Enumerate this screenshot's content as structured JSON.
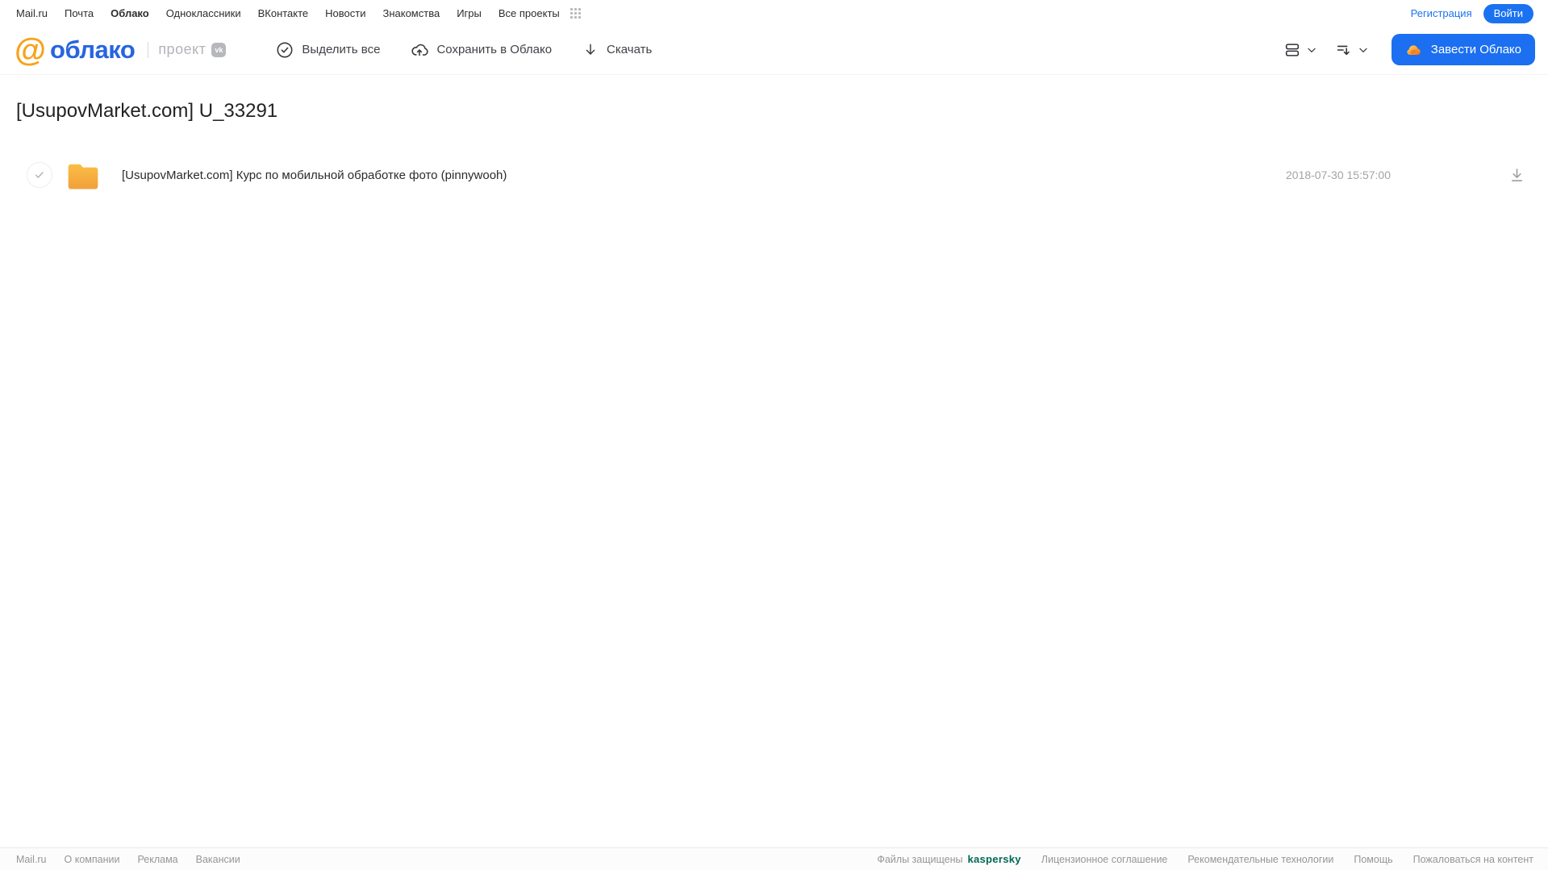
{
  "top_nav": {
    "links": [
      {
        "label": "Mail.ru",
        "active": false
      },
      {
        "label": "Почта",
        "active": false
      },
      {
        "label": "Облако",
        "active": true
      },
      {
        "label": "Одноклассники",
        "active": false
      },
      {
        "label": "ВКонтакте",
        "active": false
      },
      {
        "label": "Новости",
        "active": false
      },
      {
        "label": "Знакомства",
        "active": false
      },
      {
        "label": "Игры",
        "active": false
      },
      {
        "label": "Все проекты",
        "active": false
      }
    ],
    "registration_label": "Регистрация",
    "login_label": "Войти"
  },
  "header": {
    "logo_at": "@",
    "logo_text": "облако",
    "project_label": "проект",
    "vk_badge": "vk",
    "toolbar": {
      "select_all": "Выделить все",
      "save_to_cloud": "Сохранить в Облако",
      "download": "Скачать"
    },
    "get_cloud_label": "Завести Облако"
  },
  "main": {
    "title": "[UsupovMarket.com] U_33291",
    "files": [
      {
        "type": "folder",
        "name": "[UsupovMarket.com] Курс по мобильной обработке фото (pinnywooh)",
        "date": "2018-07-30 15:57:00"
      }
    ]
  },
  "footer": {
    "left_links": [
      {
        "label": "Mail.ru"
      },
      {
        "label": "О компании"
      },
      {
        "label": "Реклама"
      },
      {
        "label": "Вакансии"
      }
    ],
    "protected_label": "Файлы защищены",
    "kaspersky_label": "kaspersky",
    "right_links": [
      {
        "label": "Лицензионное соглашение"
      },
      {
        "label": "Рекомендательные технологии"
      },
      {
        "label": "Помощь"
      },
      {
        "label": "Пожаловаться на контент"
      }
    ]
  },
  "icons": {
    "all_projects_grid": "grid-9-dots",
    "select_all": "check-circle",
    "save_to_cloud": "cloud-arrow-up",
    "download": "arrow-down",
    "view_mode": "stacked-rows",
    "sort": "sort-lines-arrow-down",
    "chevron": "chevron-down",
    "get_cloud": "orange-cloud",
    "file": "folder",
    "row_checkbox": "circle-check",
    "row_download": "arrow-down-underline"
  },
  "colors": {
    "accent_blue": "#1b72f0",
    "logo_orange": "#f7a21c",
    "logo_blue": "#2765e0",
    "folder_top": "#fcbd45",
    "folder_bottom": "#f1a03a",
    "kaspersky_teal": "#006858",
    "muted_gray": "#a4a4a6"
  }
}
